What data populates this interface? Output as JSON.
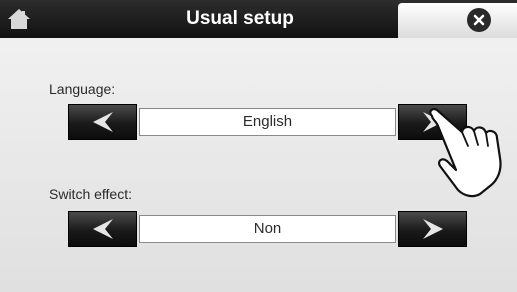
{
  "header": {
    "title": "Usual setup",
    "home_icon": "home-icon",
    "close_icon": "close-circle-x-icon",
    "background_color": "#111111"
  },
  "settings": [
    {
      "label": "Language:",
      "value": "English"
    },
    {
      "label": "Switch effect:",
      "value": "Non"
    }
  ],
  "pointer_icon": "hand-pointer-icon"
}
